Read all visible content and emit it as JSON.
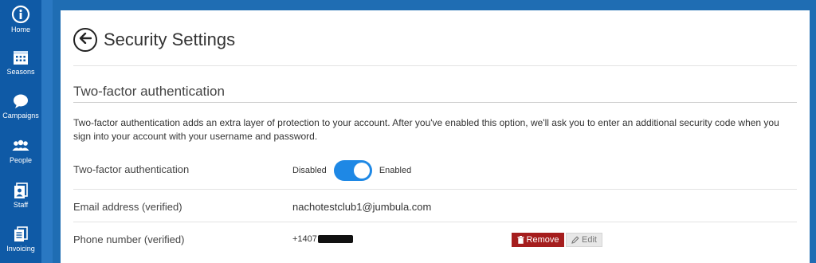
{
  "sidebar": {
    "items": [
      {
        "label": "Home",
        "icon": "info-icon"
      },
      {
        "label": "Seasons",
        "icon": "calendar-icon"
      },
      {
        "label": "Campaigns",
        "icon": "speech-bubble-icon"
      },
      {
        "label": "People",
        "icon": "people-icon"
      },
      {
        "label": "Staff",
        "icon": "staff-icon"
      },
      {
        "label": "Invoicing",
        "icon": "invoice-icon"
      }
    ]
  },
  "header": {
    "title": "Security Settings"
  },
  "section": {
    "title": "Two-factor authentication",
    "description": "Two-factor authentication adds an extra layer of protection to your account. After you've enabled this option, we'll ask you to enter an additional security code when you sign into your account with your username and password."
  },
  "tfa_row": {
    "label": "Two-factor authentication",
    "off_label": "Disabled",
    "on_label": "Enabled",
    "enabled": true
  },
  "email_row": {
    "label": "Email address (verified)",
    "value": "nachotestclub1@jumbula.com"
  },
  "phone_row": {
    "label": "Phone number (verified)",
    "value_prefix": "+1407",
    "remove_label": "Remove",
    "edit_label": "Edit"
  },
  "colors": {
    "sidebar": "#0f5aa6",
    "accent": "#1e88e5",
    "danger": "#a51d1d"
  }
}
